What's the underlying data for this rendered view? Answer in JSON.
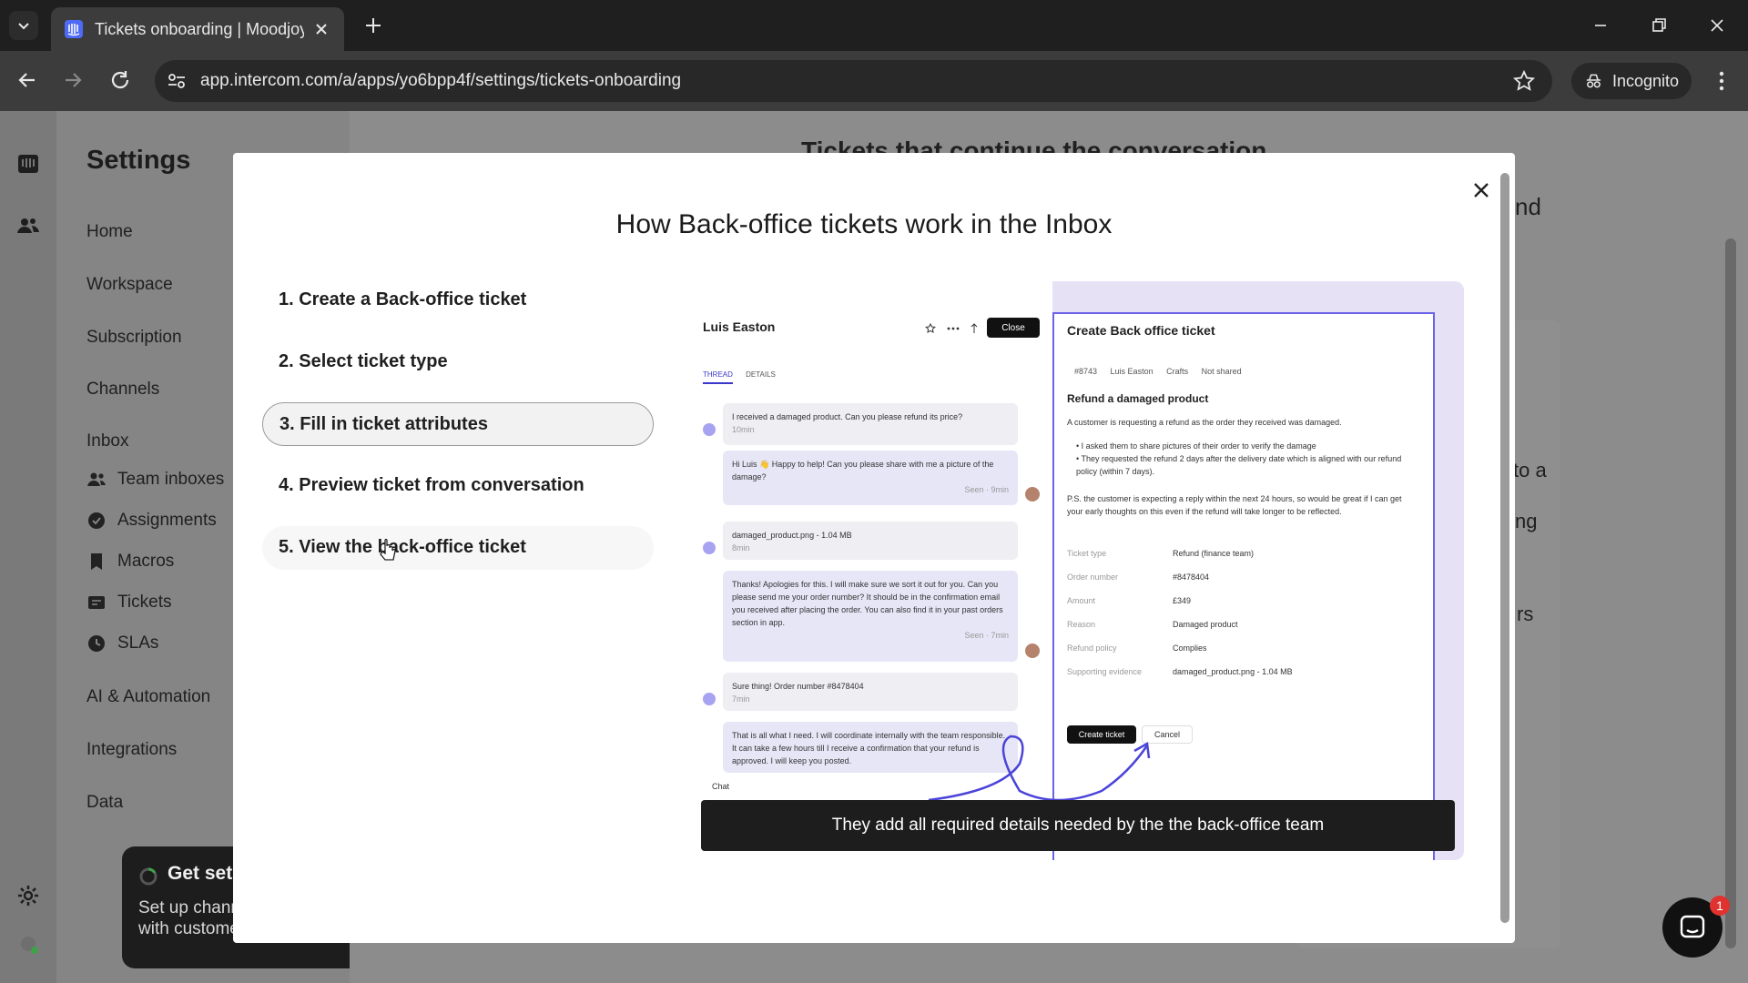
{
  "browser": {
    "tab_title": "Tickets onboarding | Moodjoy |",
    "url": "app.intercom.com/a/apps/yo6bpp4f/settings/tickets-onboarding",
    "incognito_label": "Incognito"
  },
  "sidebar": {
    "title": "Settings",
    "items": [
      "Home",
      "Workspace",
      "Subscription",
      "Channels",
      "Inbox"
    ],
    "inbox_subitems": [
      {
        "label": "Team inboxes",
        "icon": "team-icon"
      },
      {
        "label": "Assignments",
        "icon": "assign-icon"
      },
      {
        "label": "Macros",
        "icon": "bookmark-icon"
      },
      {
        "label": "Tickets",
        "icon": "ticket-icon"
      },
      {
        "label": "SLAs",
        "icon": "clock-icon"
      }
    ],
    "more_items": [
      "AI & Automation",
      "Integrations",
      "Data"
    ]
  },
  "setup_card": {
    "title": "Get set up",
    "desc": "Set up channels to with customers"
  },
  "background_fragments": {
    "heading": "Tickets that continue the conversation",
    "frag1": "nd",
    "frag2": "to a",
    "frag3": "ng",
    "frag4": "rs"
  },
  "chat_widget": {
    "badge": "1"
  },
  "modal": {
    "title": "How Back-office tickets work in the Inbox",
    "steps": [
      "1. Create a Back-office ticket",
      "2. Select ticket type",
      "3. Fill in ticket attributes",
      "4. Preview ticket from conversation",
      "5. View the back-office ticket"
    ],
    "active_step": 3,
    "caption": "They add all required details needed by the the back-office team"
  },
  "preview": {
    "conversation": {
      "name": "Luis Easton",
      "close_label": "Close",
      "tabs": [
        "THREAD",
        "DETAILS"
      ],
      "messages": [
        {
          "text": "I received a damaged product. Can you please refund its price?",
          "meta": "10min"
        },
        {
          "text": "Hi Luis 👋 Happy to help! Can you please share with me a picture of the damage?",
          "meta": "Seen · 9min"
        },
        {
          "text": "damaged_product.png - 1.04 MB",
          "meta": "8min"
        },
        {
          "text": "Thanks! Apologies for this. I will make sure we sort it out for you. Can you please send me your order number? It should be in the confirmation email you received after placing the order. You can also find it in your past orders section in app.",
          "meta": "Seen · 7min"
        },
        {
          "text": "Sure thing! Order number #8478404",
          "meta": "7min"
        },
        {
          "text": "That is all what I need. I will coordinate internally with the team responsible. It can take a few hours till I receive a confirmation that your refund is approved. I will keep you posted.",
          "meta": ""
        }
      ],
      "chat_label": "Chat"
    },
    "form": {
      "title": "Create Back office ticket",
      "meta": [
        "#8743",
        "Luis Easton",
        "Crafts",
        "Not shared"
      ],
      "heading": "Refund a damaged product",
      "intro": "A customer is requesting a refund as the order they received was damaged.",
      "bullets": [
        "I asked them to share pictures of their order to verify the damage",
        "They requested the refund 2 days after the delivery date which is aligned with our refund policy (within 7 days)."
      ],
      "ps": "P.S. the customer is expecting a reply within the next 24 hours, so would be great if I can get your early thoughts on this even if the refund will take longer to be reflected.",
      "fields": [
        {
          "key": "Ticket type",
          "value": "Refund (finance team)"
        },
        {
          "key": "Order number",
          "value": "#8478404"
        },
        {
          "key": "Amount",
          "value": "£349"
        },
        {
          "key": "Reason",
          "value": "Damaged product"
        },
        {
          "key": "Refund policy",
          "value": "Complies"
        },
        {
          "key": "Supporting evidence",
          "value": "damaged_product.png - 1.04 MB"
        }
      ],
      "create_label": "Create ticket",
      "cancel_label": "Cancel"
    }
  }
}
